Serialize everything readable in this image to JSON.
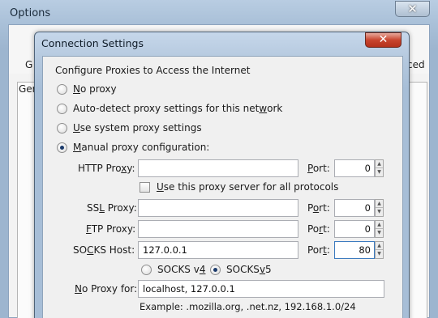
{
  "background_window": {
    "title": "Options",
    "close_glyph": "✕",
    "tab_left_partial": "G",
    "tab_right_partial": "ced",
    "panel_tab_partial": "Ger"
  },
  "dialog": {
    "title": "Connection Settings",
    "close_glyph": "✕",
    "group_label": "Configure Proxies to Access the Internet",
    "proxy_options": [
      {
        "prefix": "",
        "accel": "N",
        "suffix": "o proxy",
        "checked": false
      },
      {
        "prefix": "Auto-detect proxy settings for this net",
        "accel": "w",
        "suffix": "ork",
        "checked": false
      },
      {
        "prefix": "",
        "accel": "U",
        "suffix": "se system proxy settings",
        "checked": false
      },
      {
        "prefix": "",
        "accel": "M",
        "suffix": "anual proxy configuration:",
        "checked": true
      }
    ],
    "http": {
      "label_prefix": "HTTP Pro",
      "label_accel": "x",
      "label_suffix": "y:",
      "host": "",
      "port_prefix": "",
      "port_accel": "P",
      "port_suffix": "ort:",
      "port": "0"
    },
    "share_proxy": {
      "prefix": "",
      "accel": "U",
      "suffix": "se this proxy server for all protocols",
      "checked": false
    },
    "ssl": {
      "label_prefix": "SS",
      "label_accel": "L",
      "label_suffix": " Proxy:",
      "host": "",
      "port_prefix": "P",
      "port_accel": "o",
      "port_suffix": "rt:",
      "port": "0"
    },
    "ftp": {
      "label_prefix": "",
      "label_accel": "F",
      "label_suffix": "TP Proxy:",
      "host": "",
      "port_prefix": "Po",
      "port_accel": "r",
      "port_suffix": "t:",
      "port": "0"
    },
    "socks": {
      "label_prefix": "SO",
      "label_accel": "C",
      "label_suffix": "KS Host:",
      "host": "127.0.0.1",
      "port_prefix": "Por",
      "port_accel": "t",
      "port_suffix": ":",
      "port": "80"
    },
    "socks_versions": [
      {
        "prefix": "SOCKS v",
        "accel": "4",
        "suffix": "",
        "checked": false
      },
      {
        "prefix": "SOCKS ",
        "accel": "v",
        "suffix": "5",
        "checked": true
      }
    ],
    "no_proxy": {
      "label_prefix": "",
      "label_accel": "N",
      "label_suffix": "o Proxy for:",
      "value": "localhost, 127.0.0.1"
    },
    "example_hint": "Example: .mozilla.org, .net.nz, 192.168.1.0/24",
    "spin_up_glyph": "▲",
    "spin_down_glyph": "▼"
  }
}
